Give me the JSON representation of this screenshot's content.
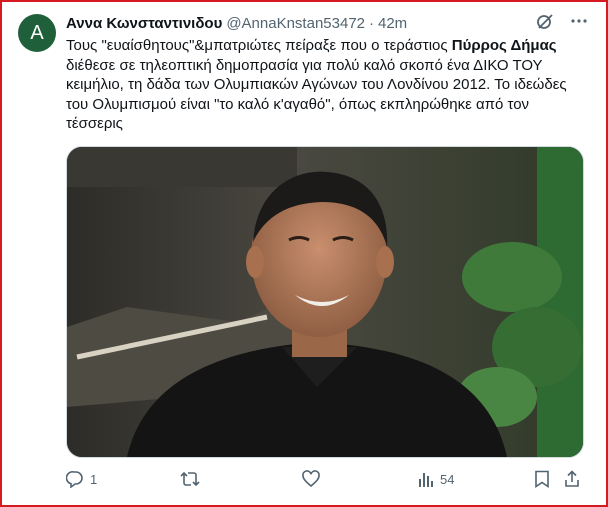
{
  "author": {
    "avatar_letter": "A",
    "name": "Αννα Κωνσταντινιδου",
    "handle": "@AnnaKnstan53472",
    "separator": "·",
    "time": "42m"
  },
  "tweet": {
    "text_parts": [
      "Τους \"ευαίσθητους\"&μπατριώτες πείραξε που ο τεράστιος ",
      "Πύρρος Δήμας",
      " διέθεσε σε τηλεοπτική δημοπρασία για πολύ καλό σκοπό ένα ΔΙΚΟ ΤΟΥ κειμήλιο, τη δάδα των Ολυμπιακών Αγώνων του Λονδίνου 2012. Το ιδεώδες του Ολυμπισμού είναι \"το καλό κ'αγαθό\", όπως εκπληρώθηκε από τον τέσσερις"
    ]
  },
  "actions": {
    "replies": "1",
    "retweets": "",
    "likes": "",
    "views": "54"
  },
  "colors": {
    "text": "#0f1419",
    "secondary": "#536471",
    "frame": "#d71920",
    "avatar_bg": "#1f5f3a"
  },
  "icons": [
    "grok-icon",
    "more-icon",
    "reply-icon",
    "retweet-icon",
    "like-icon",
    "views-icon",
    "bookmark-icon",
    "share-icon"
  ]
}
